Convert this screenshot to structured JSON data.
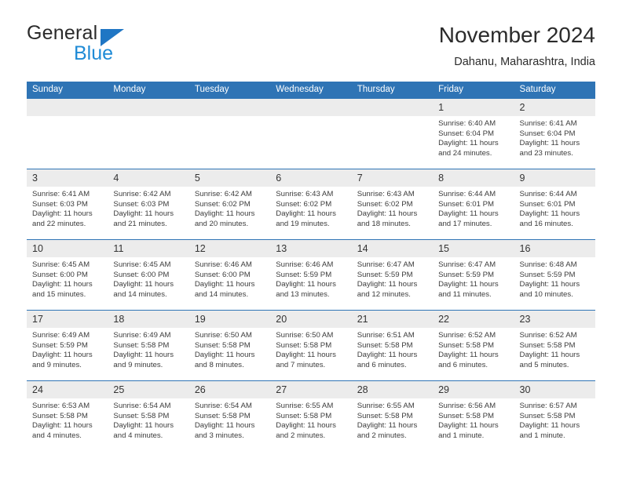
{
  "brand": {
    "name_top": "General",
    "name_bottom": "Blue",
    "triangle_color": "#1f76c4",
    "blue_text_color": "#1f8bd6"
  },
  "header": {
    "title": "November 2024",
    "subtitle": "Dahanu, Maharashtra, India"
  },
  "theme": {
    "header_blue": "#2f74b5",
    "date_band_gray": "#ececec",
    "text_color": "#333333"
  },
  "weekdays": [
    "Sunday",
    "Monday",
    "Tuesday",
    "Wednesday",
    "Thursday",
    "Friday",
    "Saturday"
  ],
  "weeks": [
    [
      {
        "day": "",
        "sunrise": "",
        "sunset": "",
        "daylight": ""
      },
      {
        "day": "",
        "sunrise": "",
        "sunset": "",
        "daylight": ""
      },
      {
        "day": "",
        "sunrise": "",
        "sunset": "",
        "daylight": ""
      },
      {
        "day": "",
        "sunrise": "",
        "sunset": "",
        "daylight": ""
      },
      {
        "day": "",
        "sunrise": "",
        "sunset": "",
        "daylight": ""
      },
      {
        "day": "1",
        "sunrise": "Sunrise: 6:40 AM",
        "sunset": "Sunset: 6:04 PM",
        "daylight": "Daylight: 11 hours and 24 minutes."
      },
      {
        "day": "2",
        "sunrise": "Sunrise: 6:41 AM",
        "sunset": "Sunset: 6:04 PM",
        "daylight": "Daylight: 11 hours and 23 minutes."
      }
    ],
    [
      {
        "day": "3",
        "sunrise": "Sunrise: 6:41 AM",
        "sunset": "Sunset: 6:03 PM",
        "daylight": "Daylight: 11 hours and 22 minutes."
      },
      {
        "day": "4",
        "sunrise": "Sunrise: 6:42 AM",
        "sunset": "Sunset: 6:03 PM",
        "daylight": "Daylight: 11 hours and 21 minutes."
      },
      {
        "day": "5",
        "sunrise": "Sunrise: 6:42 AM",
        "sunset": "Sunset: 6:02 PM",
        "daylight": "Daylight: 11 hours and 20 minutes."
      },
      {
        "day": "6",
        "sunrise": "Sunrise: 6:43 AM",
        "sunset": "Sunset: 6:02 PM",
        "daylight": "Daylight: 11 hours and 19 minutes."
      },
      {
        "day": "7",
        "sunrise": "Sunrise: 6:43 AM",
        "sunset": "Sunset: 6:02 PM",
        "daylight": "Daylight: 11 hours and 18 minutes."
      },
      {
        "day": "8",
        "sunrise": "Sunrise: 6:44 AM",
        "sunset": "Sunset: 6:01 PM",
        "daylight": "Daylight: 11 hours and 17 minutes."
      },
      {
        "day": "9",
        "sunrise": "Sunrise: 6:44 AM",
        "sunset": "Sunset: 6:01 PM",
        "daylight": "Daylight: 11 hours and 16 minutes."
      }
    ],
    [
      {
        "day": "10",
        "sunrise": "Sunrise: 6:45 AM",
        "sunset": "Sunset: 6:00 PM",
        "daylight": "Daylight: 11 hours and 15 minutes."
      },
      {
        "day": "11",
        "sunrise": "Sunrise: 6:45 AM",
        "sunset": "Sunset: 6:00 PM",
        "daylight": "Daylight: 11 hours and 14 minutes."
      },
      {
        "day": "12",
        "sunrise": "Sunrise: 6:46 AM",
        "sunset": "Sunset: 6:00 PM",
        "daylight": "Daylight: 11 hours and 14 minutes."
      },
      {
        "day": "13",
        "sunrise": "Sunrise: 6:46 AM",
        "sunset": "Sunset: 5:59 PM",
        "daylight": "Daylight: 11 hours and 13 minutes."
      },
      {
        "day": "14",
        "sunrise": "Sunrise: 6:47 AM",
        "sunset": "Sunset: 5:59 PM",
        "daylight": "Daylight: 11 hours and 12 minutes."
      },
      {
        "day": "15",
        "sunrise": "Sunrise: 6:47 AM",
        "sunset": "Sunset: 5:59 PM",
        "daylight": "Daylight: 11 hours and 11 minutes."
      },
      {
        "day": "16",
        "sunrise": "Sunrise: 6:48 AM",
        "sunset": "Sunset: 5:59 PM",
        "daylight": "Daylight: 11 hours and 10 minutes."
      }
    ],
    [
      {
        "day": "17",
        "sunrise": "Sunrise: 6:49 AM",
        "sunset": "Sunset: 5:59 PM",
        "daylight": "Daylight: 11 hours and 9 minutes."
      },
      {
        "day": "18",
        "sunrise": "Sunrise: 6:49 AM",
        "sunset": "Sunset: 5:58 PM",
        "daylight": "Daylight: 11 hours and 9 minutes."
      },
      {
        "day": "19",
        "sunrise": "Sunrise: 6:50 AM",
        "sunset": "Sunset: 5:58 PM",
        "daylight": "Daylight: 11 hours and 8 minutes."
      },
      {
        "day": "20",
        "sunrise": "Sunrise: 6:50 AM",
        "sunset": "Sunset: 5:58 PM",
        "daylight": "Daylight: 11 hours and 7 minutes."
      },
      {
        "day": "21",
        "sunrise": "Sunrise: 6:51 AM",
        "sunset": "Sunset: 5:58 PM",
        "daylight": "Daylight: 11 hours and 6 minutes."
      },
      {
        "day": "22",
        "sunrise": "Sunrise: 6:52 AM",
        "sunset": "Sunset: 5:58 PM",
        "daylight": "Daylight: 11 hours and 6 minutes."
      },
      {
        "day": "23",
        "sunrise": "Sunrise: 6:52 AM",
        "sunset": "Sunset: 5:58 PM",
        "daylight": "Daylight: 11 hours and 5 minutes."
      }
    ],
    [
      {
        "day": "24",
        "sunrise": "Sunrise: 6:53 AM",
        "sunset": "Sunset: 5:58 PM",
        "daylight": "Daylight: 11 hours and 4 minutes."
      },
      {
        "day": "25",
        "sunrise": "Sunrise: 6:54 AM",
        "sunset": "Sunset: 5:58 PM",
        "daylight": "Daylight: 11 hours and 4 minutes."
      },
      {
        "day": "26",
        "sunrise": "Sunrise: 6:54 AM",
        "sunset": "Sunset: 5:58 PM",
        "daylight": "Daylight: 11 hours and 3 minutes."
      },
      {
        "day": "27",
        "sunrise": "Sunrise: 6:55 AM",
        "sunset": "Sunset: 5:58 PM",
        "daylight": "Daylight: 11 hours and 2 minutes."
      },
      {
        "day": "28",
        "sunrise": "Sunrise: 6:55 AM",
        "sunset": "Sunset: 5:58 PM",
        "daylight": "Daylight: 11 hours and 2 minutes."
      },
      {
        "day": "29",
        "sunrise": "Sunrise: 6:56 AM",
        "sunset": "Sunset: 5:58 PM",
        "daylight": "Daylight: 11 hours and 1 minute."
      },
      {
        "day": "30",
        "sunrise": "Sunrise: 6:57 AM",
        "sunset": "Sunset: 5:58 PM",
        "daylight": "Daylight: 11 hours and 1 minute."
      }
    ]
  ]
}
